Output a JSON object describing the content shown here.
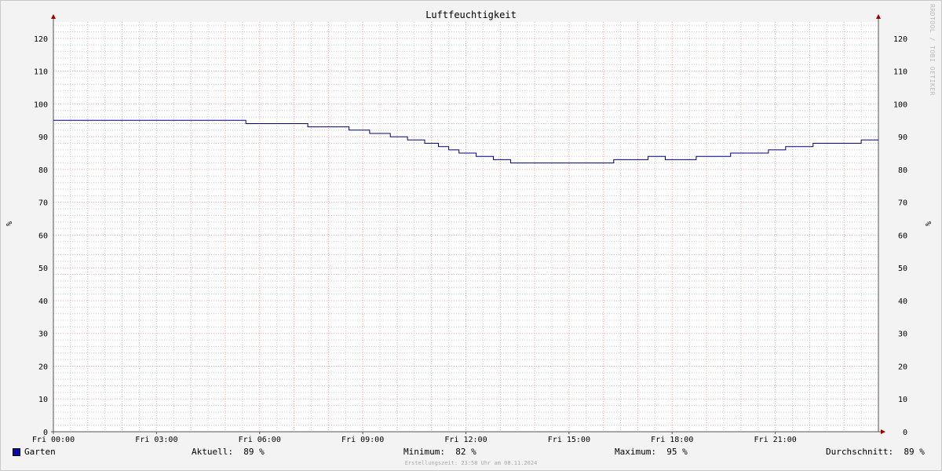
{
  "chart_data": {
    "type": "line",
    "title": "Luftfeuchtigkeit",
    "ylabel": "%",
    "ylim": [
      0,
      125
    ],
    "yticks": [
      0,
      10,
      20,
      30,
      40,
      50,
      60,
      70,
      80,
      90,
      100,
      110,
      120
    ],
    "xlim": [
      0,
      24
    ],
    "xticks": [
      {
        "t": 0,
        "label": "Fri 00:00"
      },
      {
        "t": 3,
        "label": "Fri 03:00"
      },
      {
        "t": 6,
        "label": "Fri 06:00"
      },
      {
        "t": 9,
        "label": "Fri 09:00"
      },
      {
        "t": 12,
        "label": "Fri 12:00"
      },
      {
        "t": 15,
        "label": "Fri 15:00"
      },
      {
        "t": 18,
        "label": "Fri 18:00"
      },
      {
        "t": 21,
        "label": "Fri 21:00"
      }
    ],
    "grid": true,
    "colors": {
      "series": "#00007a",
      "legend_swatch": "#0a0a9e",
      "major_grid": "#f0a0a0",
      "minor_grid": "#cccccc",
      "axis_arrow": "#990000"
    },
    "series": [
      {
        "name": "Garten",
        "x": [
          0,
          5.6,
          7.4,
          8.6,
          9.2,
          9.8,
          10.3,
          10.8,
          11.2,
          11.5,
          11.8,
          12.3,
          12.8,
          13.3,
          16.3,
          17.3,
          17.8,
          18.7,
          19.7,
          20.8,
          21.3,
          22.1,
          23.5,
          24
        ],
        "values": [
          95,
          94,
          93,
          92,
          91,
          90,
          89,
          88,
          87,
          86,
          85,
          84,
          83,
          82,
          83,
          84,
          83,
          84,
          85,
          86,
          87,
          88,
          89,
          89
        ]
      }
    ]
  },
  "legend": {
    "series_name": "Garten",
    "current": "Aktuell:  89 %",
    "minimum": "Minimum:  82 %",
    "maximum": "Maximum:  95 %",
    "average": "Durchschnitt:  89 %"
  },
  "watermark": "RRDTOOL / TOBI OETIKER",
  "footer": "Erstellungszeit: 23:58 Uhr am 08.11.2024"
}
